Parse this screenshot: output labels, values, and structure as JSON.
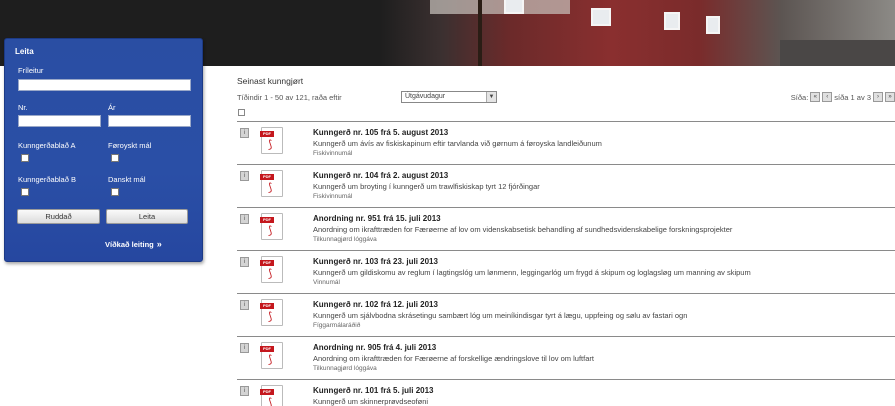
{
  "search": {
    "title": "Leita",
    "labels": {
      "freetext": "Fríleitur",
      "number": "Nr.",
      "year": "Ár",
      "kunngerdabladA": "Kunngerðablað A",
      "foroyskt": "Føroyskt mál",
      "kunngerdabladB": "Kunngerðablað B",
      "danskt": "Danskt mál"
    },
    "values": {
      "freetext": "",
      "number": "",
      "year": ""
    },
    "clear_label": "Ruddað",
    "search_label": "Leita",
    "advanced_label": "Víðkað leiting"
  },
  "main": {
    "title": "Seinast kunngjørt",
    "tidindi": "Tíðindir 1 - 50 av 121, raða eftir",
    "sort_value": "Útgávudagur",
    "pager_label": "Síða:",
    "page_text": "síða 1 av 3"
  },
  "items": [
    {
      "name": "Kunngerð nr. 105 frá 5. august 2013",
      "desc": "Kunngerð um ávís av fiskiskapinum eftir tarvlanda við gørnum á føroyska landleiðunum",
      "cat": "Fiskivinnumál"
    },
    {
      "name": "Kunngerð nr. 104 frá 2. august 2013",
      "desc": "Kunngerð um broyting í kunngerð um trawlfiskiskap tyrt 12 fjórðingar",
      "cat": "Fiskivinnumál"
    },
    {
      "name": "Anordning nr. 951 frá 15. juli 2013",
      "desc": "Anordning om ikrafttræden for Færøerne af lov om videnskabsetisk behandling af sundhedsvidenskabelige forskningsprojekter",
      "cat": "Tilkunnagjørd lóggáva"
    },
    {
      "name": "Kunngerð nr. 103 frá 23. juli 2013",
      "desc": "Kunngerð um gildiskomu av reglum í lagtingslóg um lønmenn, leggingarlóg um frygd á skipum og loglagsløg um manning av skipum",
      "cat": "Vinnumál"
    },
    {
      "name": "Kunngerð nr. 102 frá 12. juli 2013",
      "desc": "Kunngerð um sjálvbodna skrásetingu sambært lóg um meiníkindisgar tyrt á lægu, uppfeing og sølu av fastari ogn",
      "cat": "Fíggarmálaráðið"
    },
    {
      "name": "Anordning nr. 905 frá 4. juli 2013",
      "desc": "Anordning om ikrafttræden for Færøerne af forskellige ændringslove til lov om luftfart",
      "cat": "Tilkunnagjørd lóggáva"
    },
    {
      "name": "Kunngerð nr. 101 frá 5. juli 2013",
      "desc": "Kunngerð um skinnerprøvdseoføni",
      "cat": ""
    }
  ]
}
